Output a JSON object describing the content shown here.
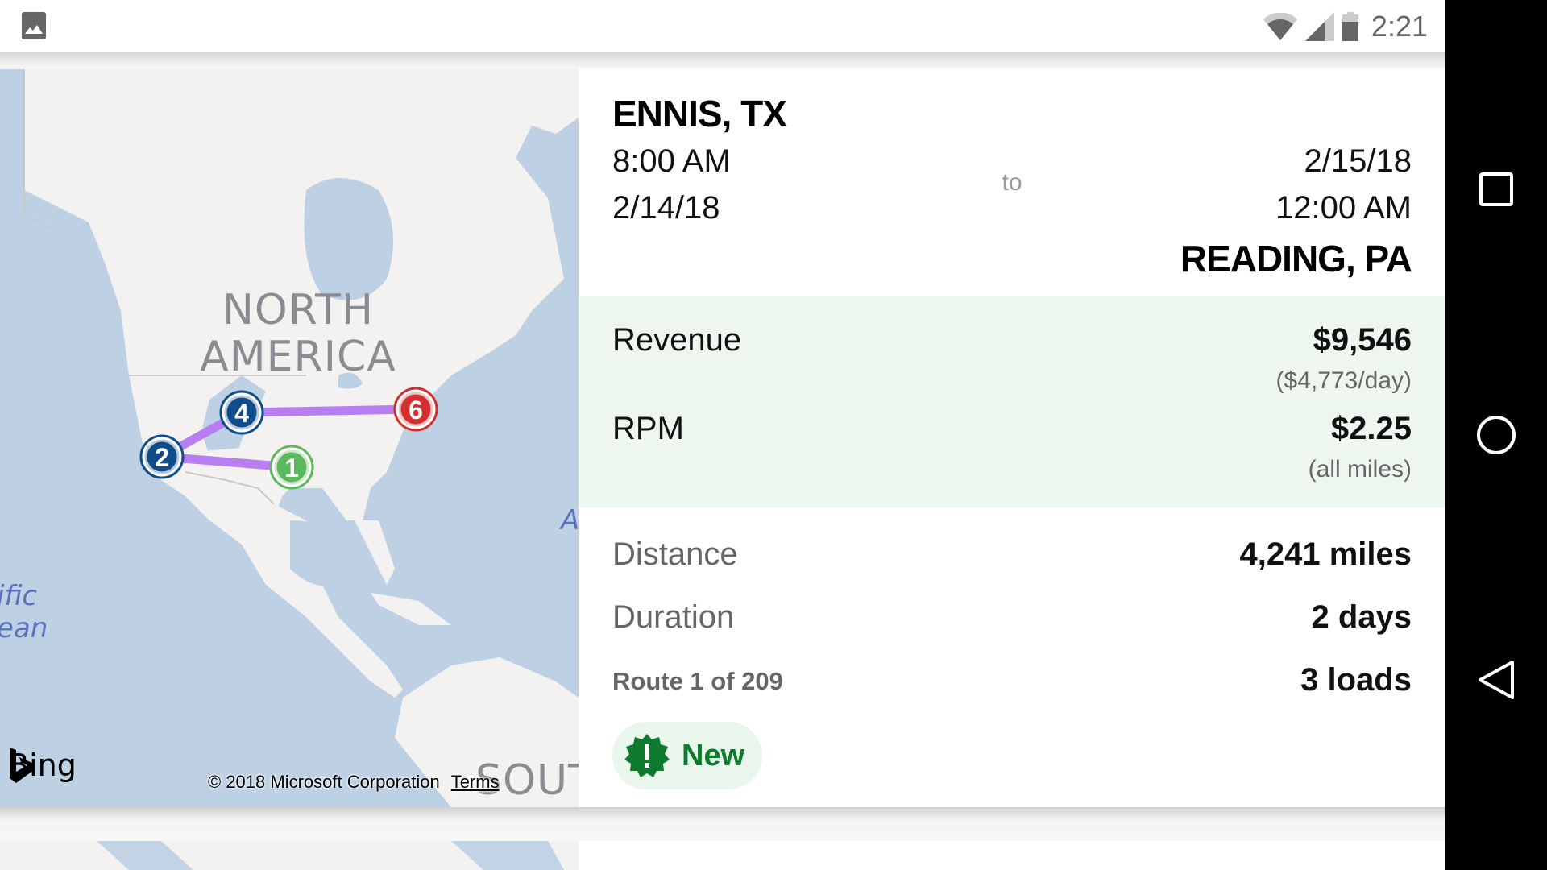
{
  "status_bar": {
    "notification_icon": "image-icon",
    "wifi_icon": "wifi-icon",
    "signal_icon": "cell-signal-icon",
    "battery_icon": "battery-icon",
    "time": "2:21"
  },
  "nav_bar": {
    "buttons": [
      {
        "name": "recents",
        "icon": "square-icon"
      },
      {
        "name": "home",
        "icon": "circle-icon"
      },
      {
        "name": "back",
        "icon": "triangle-back-icon"
      }
    ]
  },
  "map": {
    "continent_label_line1": "NORTH",
    "continent_label_line2": "AMERICA",
    "ocean_label_line1": "ific",
    "ocean_label_line2": "ean",
    "atlantic_fragment": "A",
    "south_label": "SOUT",
    "provider": "Bing",
    "copyright": "© 2018 Microsoft Corporation",
    "terms_link": "Terms",
    "route_color": "#b77ef0",
    "markers": [
      {
        "label": "1",
        "color": "#5cb85c",
        "role": "origin"
      },
      {
        "label": "2",
        "color": "#0f4c8a",
        "role": "stop"
      },
      {
        "label": "4",
        "color": "#0f4c8a",
        "role": "stop"
      },
      {
        "label": "6",
        "color": "#d32f2f",
        "role": "destination"
      }
    ]
  },
  "trip": {
    "origin": {
      "city": "ENNIS, TX",
      "time": "8:00 AM",
      "date": "2/14/18"
    },
    "separator": "to",
    "destination": {
      "date": "2/15/18",
      "time": "12:00 AM",
      "city": "READING, PA"
    }
  },
  "finance": {
    "revenue_label": "Revenue",
    "revenue_value": "$9,546",
    "revenue_sub": "($4,773/day)",
    "rpm_label": "RPM",
    "rpm_value": "$2.25",
    "rpm_sub": "(all miles)",
    "background_color": "#eef7ef"
  },
  "stats": {
    "distance_label": "Distance",
    "distance_value": "4,241 miles",
    "duration_label": "Duration",
    "duration_value": "2 days",
    "route_label": "Route 1 of 209",
    "loads_value": "3 loads"
  },
  "badge": {
    "icon": "new-releases-icon",
    "label": "New",
    "color": "#0d7a2e"
  }
}
